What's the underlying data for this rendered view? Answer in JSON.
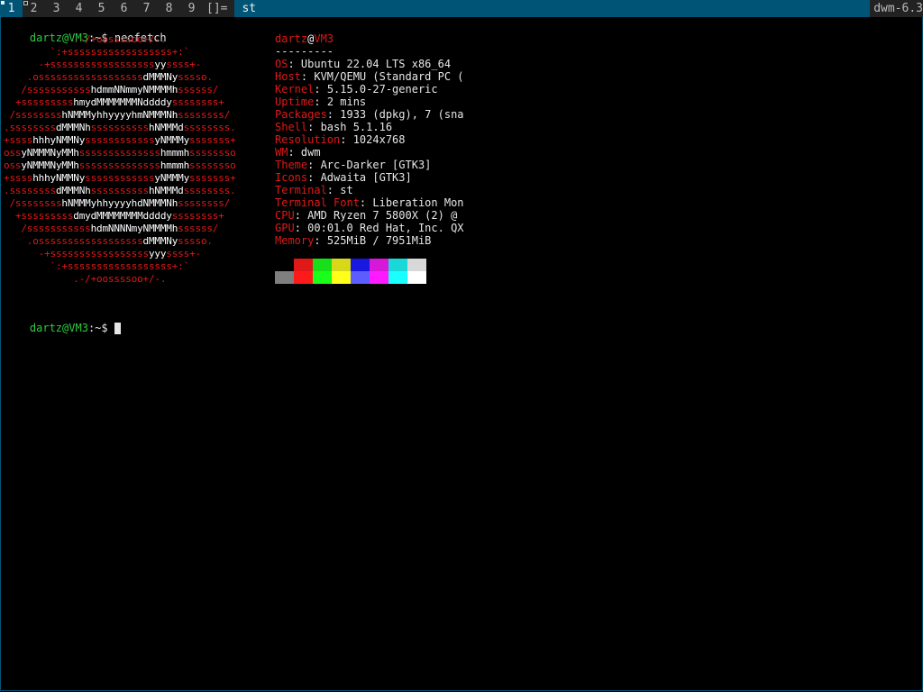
{
  "bar": {
    "tags": [
      "1",
      "2",
      "3",
      "4",
      "5",
      "6",
      "7",
      "8",
      "9"
    ],
    "layout": "[]=",
    "title": "st",
    "status": "dwm-6.3"
  },
  "prompt": {
    "user": "dartz",
    "at": "@",
    "host": "VM3",
    "sep": ":~$ ",
    "command": "neofetch"
  },
  "logo": [
    "            .-/+oossssoo+/-.",
    "        `:+ssssssssssssssssss+:`",
    "      -+ssssssssssssssssssyyssss+-",
    "    .ossssssssssssssssssdMMMNysssso.",
    "   /ssssssssssshdmmNNmmyNMMMMhssssss/",
    "  +ssssssssshmydMMMMMMMNddddyssssssss+",
    " /sssssssshNMMMyhhyyyyhmNMMMNhssssssss/",
    ".ssssssssdMMMNhsssssssssshNMMMdssssssss.",
    "+sssshhhyNMMNyssssssssssssyNMMMysssssss+",
    "ossyNMMMNyMMhsssssssssssssshmmmhssssssso",
    "ossyNMMMNyMMhsssssssssssssshmmmhssssssso",
    "+sssshhhyNMMNyssssssssssssyNMMMysssssss+",
    ".ssssssssdMMMNhsssssssssshNMMMdssssssss.",
    " /sssssssshNMMMyhhyyyyhdNMMMNhssssssss/",
    "  +sssssssssdmydMMMMMMMMddddyssssssss+",
    "   /ssssssssssshdmNNNNmyNMMMMhssssss/",
    "    .ossssssssssssssssssdMMMNysssso.",
    "      -+sssssssssssssssssyyyssss+-",
    "        `:+ssssssssssssssssss+:`",
    "            .-/+oossssoo+/-."
  ],
  "info": {
    "user": "dartz",
    "at": "@",
    "host": "VM3",
    "underline": "---------",
    "fields": [
      {
        "key": "OS",
        "value": "Ubuntu 22.04 LTS x86_64"
      },
      {
        "key": "Host",
        "value": "KVM/QEMU (Standard PC ("
      },
      {
        "key": "Kernel",
        "value": "5.15.0-27-generic"
      },
      {
        "key": "Uptime",
        "value": "2 mins"
      },
      {
        "key": "Packages",
        "value": "1933 (dpkg), 7 (sna"
      },
      {
        "key": "Shell",
        "value": "bash 5.1.16"
      },
      {
        "key": "Resolution",
        "value": "1024x768"
      },
      {
        "key": "WM",
        "value": "dwm"
      },
      {
        "key": "Theme",
        "value": "Arc-Darker [GTK3]"
      },
      {
        "key": "Icons",
        "value": "Adwaita [GTK3]"
      },
      {
        "key": "Terminal",
        "value": "st"
      },
      {
        "key": "Terminal Font",
        "value": "Liberation Mon"
      },
      {
        "key": "CPU",
        "value": "AMD Ryzen 7 5800X (2) @"
      },
      {
        "key": "GPU",
        "value": "00:01.0 Red Hat, Inc. QX"
      },
      {
        "key": "Memory",
        "value": "525MiB / 7951MiB"
      }
    ]
  },
  "palette": {
    "row1": [
      "#000000",
      "#e01818",
      "#18e018",
      "#d8d818",
      "#1818e0",
      "#d818d8",
      "#18d8d8",
      "#d8d8d8"
    ],
    "row2": [
      "#7f7f7f",
      "#ff1a1a",
      "#1aff1a",
      "#ffff1a",
      "#5c5cff",
      "#ff1aff",
      "#1affff",
      "#ffffff"
    ]
  }
}
